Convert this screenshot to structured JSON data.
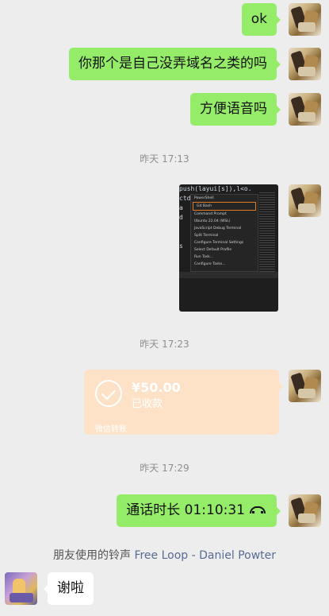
{
  "messages": {
    "m1": "ok",
    "m2": "你那个是自己没弄域名之类的吗",
    "m3": "方便语音吗",
    "m6": "通话时长 01:10:31",
    "m7": "谢啦"
  },
  "timestamps": {
    "t1": "昨天 17:13",
    "t2": "昨天 17:23",
    "t3": "昨天 17:29"
  },
  "screenshot_image": {
    "code_lines": [
      "push(layui[s]),l<o.",
      "ctd<",
      "a",
      "d",
      "",
      "",
      "s",
      "",
      "",
      "",
      "",
      ""
    ],
    "menu_items": [
      "PowerShell",
      "Git Bash",
      "Command Prompt",
      "Ubuntu 22.04 (WSL)",
      "JavaScript Debug Terminal",
      "Split Terminal",
      "Configure Terminal Settings",
      "Select Default Profile",
      "Run Task...",
      "Configure Tasks..."
    ],
    "selected_item": "Git Bash",
    "highlight_color": "#e07b24"
  },
  "transfer": {
    "amount": "¥50.00",
    "status": "已收款",
    "footer": "微信转账",
    "color": "#fde2c7"
  },
  "ringtone": {
    "prefix": "朋友使用的铃声",
    "song": "Free Loop - Daniel Powter"
  },
  "colors": {
    "background": "#ededed",
    "my_bubble": "#95ec69",
    "other_bubble": "#ffffff",
    "link": "#576b95"
  }
}
